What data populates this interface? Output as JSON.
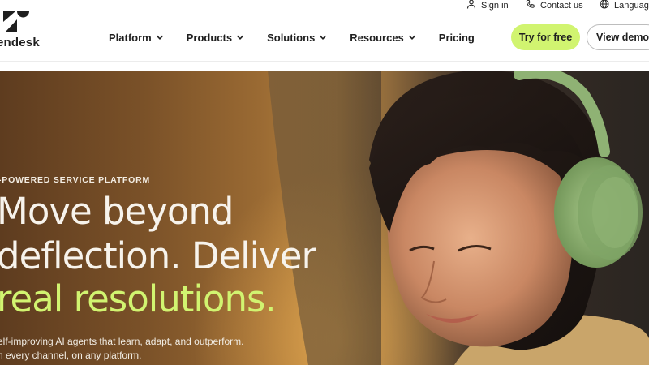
{
  "utility": {
    "sign_in": "Sign in",
    "contact_us": "Contact us",
    "language": "Languag"
  },
  "logo": {
    "wordmark": "endesk"
  },
  "nav": {
    "items": [
      {
        "label": "Platform",
        "has_dropdown": true
      },
      {
        "label": "Products",
        "has_dropdown": true
      },
      {
        "label": "Solutions",
        "has_dropdown": true
      },
      {
        "label": "Resources",
        "has_dropdown": true
      },
      {
        "label": "Pricing",
        "has_dropdown": false
      }
    ]
  },
  "cta": {
    "try_label": "Try for free",
    "demo_label": "View demo"
  },
  "hero": {
    "eyebrow": "-POWERED SERVICE PLATFORM",
    "headline_line1": "Move beyond",
    "headline_line2": "deflection. Deliver",
    "headline_line3": "real resolutions.",
    "subcopy_line1": "elf-improving AI agents that learn, adapt, and outperform.",
    "subcopy_line2": "n every channel, on any platform."
  },
  "colors": {
    "accent_lime": "#d1f470",
    "text_dark": "#1f1f1f",
    "hero_text": "#f7f3ec"
  },
  "icons": {
    "sign_in": "person-icon",
    "contact": "phone-icon",
    "language": "globe-icon",
    "dropdown": "chevron-down-icon"
  }
}
